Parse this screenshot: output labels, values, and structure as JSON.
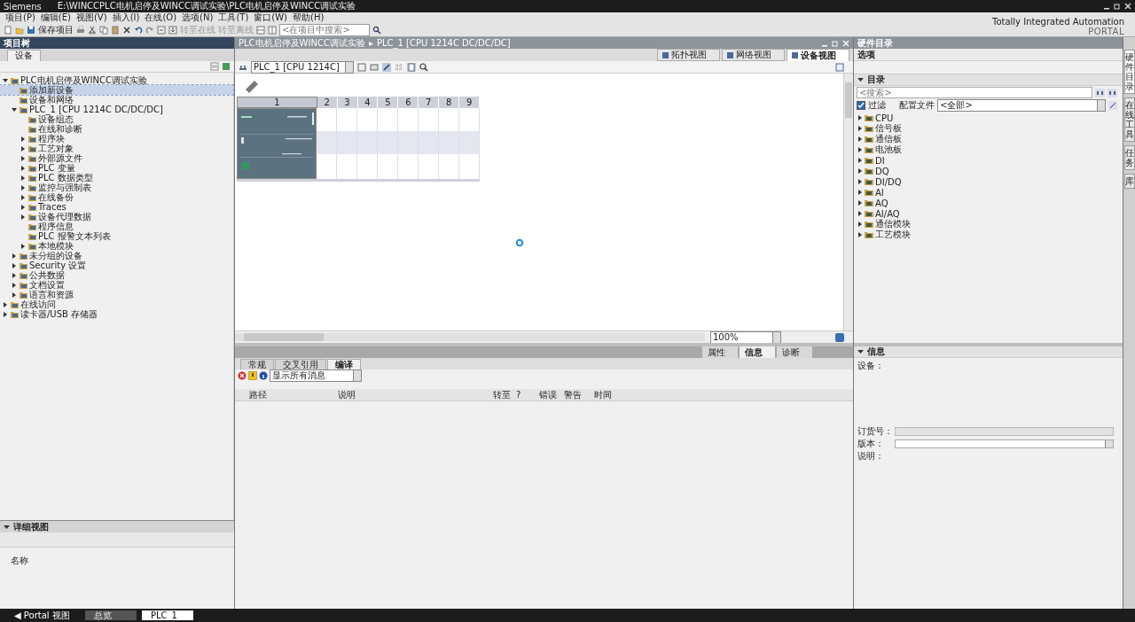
{
  "window": {
    "app": "Siemens",
    "title": "E:\\WINCCPLC电机启停及WINCC调试实验\\PLC电机启停及WINCC调试实验"
  },
  "menu": [
    "项目(P)",
    "编辑(E)",
    "视图(V)",
    "插入(I)",
    "在线(O)",
    "选项(N)",
    "工具(T)",
    "窗口(W)",
    "帮助(H)"
  ],
  "toolbar": {
    "save": "保存项目",
    "go_online": "转至在线",
    "go_offline": "转至离线",
    "search_placeholder": "<在项目中搜索>"
  },
  "brand": {
    "line1": "Totally Integrated Automation",
    "line2": "PORTAL"
  },
  "project_tree": {
    "title": "项目树",
    "tab": "设备",
    "items": [
      {
        "label": "PLC电机启停及WINCC调试实验",
        "expanded": true,
        "selected": false,
        "children": [
          {
            "label": "添加新设备",
            "selected": true
          },
          {
            "label": "设备和网络",
            "selected": false
          },
          {
            "label": "PLC_1 [CPU 1214C DC/DC/DC]",
            "expanded": true,
            "selected": false,
            "children": [
              {
                "label": "设备组态",
                "selected": false
              },
              {
                "label": "在线和诊断",
                "selected": false
              },
              {
                "label": "程序块",
                "expanded": false,
                "selected": false
              },
              {
                "label": "工艺对象",
                "expanded": false,
                "selected": false
              },
              {
                "label": "外部源文件",
                "expanded": false,
                "selected": false
              },
              {
                "label": "PLC 变量",
                "expanded": false,
                "selected": false
              },
              {
                "label": "PLC 数据类型",
                "expanded": false,
                "selected": false
              },
              {
                "label": "监控与强制表",
                "expanded": false,
                "selected": false
              },
              {
                "label": "在线备份",
                "expanded": false,
                "selected": false
              },
              {
                "label": "Traces",
                "expanded": false,
                "selected": false
              },
              {
                "label": "设备代理数据",
                "expanded": false,
                "selected": false
              },
              {
                "label": "程序信息",
                "selected": false
              },
              {
                "label": "PLC 报警文本列表",
                "selected": false
              },
              {
                "label": "本地模块",
                "expanded": false,
                "selected": false
              }
            ]
          },
          {
            "label": "未分组的设备",
            "expanded": false,
            "selected": false
          },
          {
            "label": "Security 设置",
            "expanded": false,
            "selected": false
          },
          {
            "label": "公共数据",
            "expanded": false,
            "selected": false
          },
          {
            "label": "文档设置",
            "expanded": false,
            "selected": false
          },
          {
            "label": "语言和资源",
            "expanded": false,
            "selected": false
          }
        ]
      },
      {
        "label": "在线访问",
        "expanded": false,
        "selected": false
      },
      {
        "label": "读卡器/USB 存储器",
        "expanded": false,
        "selected": false
      }
    ]
  },
  "details_view": {
    "title": "详细视图",
    "column": "名称"
  },
  "editor": {
    "breadcrumb": [
      "PLC电机启停及WINCC调试实验",
      "PLC_1 [CPU 1214C DC/DC/DC]"
    ],
    "breadcrumb_separator": "▸",
    "view_tabs": [
      {
        "label": "拓扑视图",
        "selected": false
      },
      {
        "label": "网络视图",
        "selected": false
      },
      {
        "label": "设备视图",
        "selected": true
      }
    ],
    "device_select": "PLC_1 [CPU 1214C]",
    "slots": [
      "1",
      "2",
      "3",
      "4",
      "5",
      "6",
      "7",
      "8",
      "9"
    ],
    "zoom": "100%"
  },
  "inspector": {
    "tabs": [
      {
        "label": "属性",
        "selected": false
      },
      {
        "label": "信息",
        "selected": true
      },
      {
        "label": "诊断",
        "selected": false
      }
    ],
    "sub_tabs": [
      {
        "label": "常规",
        "selected": false
      },
      {
        "label": "交叉引用",
        "selected": false
      },
      {
        "label": "编译",
        "selected": true
      }
    ],
    "filter": "显示所有消息",
    "columns": [
      "路径",
      "说明",
      "转至",
      "?",
      "错误",
      "警告",
      "时间"
    ]
  },
  "catalog": {
    "title": "硬件目录",
    "options": "选项",
    "section": "目录",
    "search_placeholder": "<搜索>",
    "filter": {
      "label": "过滤",
      "checked": true
    },
    "profile_label": "配置文件",
    "profile": "<全部>",
    "items": [
      {
        "label": "CPU",
        "expanded": false
      },
      {
        "label": "信号板",
        "expanded": false
      },
      {
        "label": "通信板",
        "expanded": false
      },
      {
        "label": "电池板",
        "expanded": false
      },
      {
        "label": "DI",
        "expanded": false
      },
      {
        "label": "DQ",
        "expanded": false
      },
      {
        "label": "DI/DQ",
        "expanded": false
      },
      {
        "label": "AI",
        "expanded": false
      },
      {
        "label": "AQ",
        "expanded": false
      },
      {
        "label": "AI/AQ",
        "expanded": false
      },
      {
        "label": "通信模块",
        "expanded": false
      },
      {
        "label": "工艺模块",
        "expanded": false
      }
    ]
  },
  "info": {
    "title": "信息",
    "fields": [
      {
        "label": "设备：",
        "kind": "none"
      },
      {
        "label": "订货号：",
        "kind": "text"
      },
      {
        "label": "版本：",
        "kind": "dropdown"
      },
      {
        "label": "说明：",
        "kind": "none"
      }
    ]
  },
  "side_tabs": [
    {
      "label": "硬件目录",
      "selected": true
    },
    {
      "label": "在线工具",
      "selected": false
    },
    {
      "label": "任务",
      "selected": false
    },
    {
      "label": "库",
      "selected": false
    }
  ],
  "taskbar": {
    "portal": "◀ Portal 视图",
    "tabs": [
      {
        "label": "总览",
        "selected": false
      },
      {
        "label": "PLC_1",
        "selected": true
      }
    ]
  }
}
